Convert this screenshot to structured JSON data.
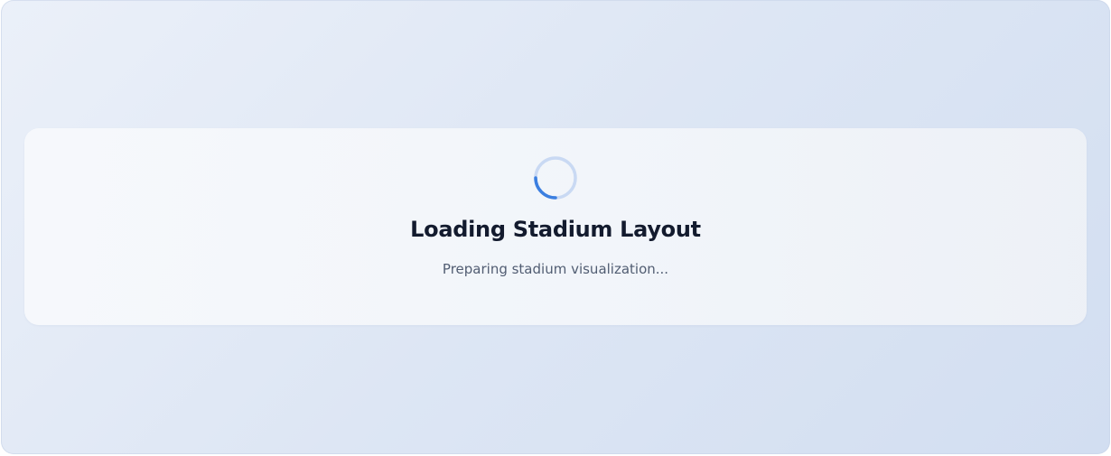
{
  "loading": {
    "title": "Loading Stadium Layout",
    "message": "Preparing stadium visualization...",
    "spinner_icon": "loading-spinner-icon"
  },
  "colors": {
    "spinner_track": "#c9d9f3",
    "spinner_arc": "#3b7fe0",
    "title": "#131b2e",
    "message": "#515d72"
  }
}
